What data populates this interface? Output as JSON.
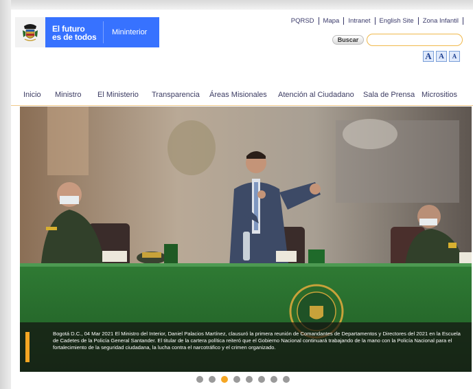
{
  "logo": {
    "line1": "El futuro",
    "line2": "es de todos",
    "ministry": "Mininterior"
  },
  "toplinks": [
    "PQRSD",
    "Mapa",
    "Intranet",
    "English Site",
    "Zona Infantil"
  ],
  "search": {
    "button_label": "Buscar",
    "value": "",
    "placeholder": ""
  },
  "font_size_controls": [
    "A",
    "A",
    "A"
  ],
  "nav": {
    "items": [
      "Inicio",
      "Ministro",
      "El Ministerio",
      "Transparencia",
      "Áreas Misionales",
      "Atención al Ciudadano",
      "Sala de Prensa",
      "Micrositios"
    ]
  },
  "hero": {
    "caption": "Bogotá D.C., 04 Mar 2021 El Ministro del Interior, Daniel Palacios Martínez, clausuró la primera reunión de Comandantes de Departamentos y Directores del 2021 en la Escuela de Cadetes de la Policía General Santander. El titular de la cartera política reiteró que el Gobierno Nacional continuará trabajando de la mano con la Policía Nacional para el fortalecimiento de la seguridad ciudadana, la lucha contra el narcotráfico y el crimen organizado.",
    "accent_color": "#f5a623"
  },
  "carousel": {
    "slide_count": 8,
    "active_index": 2
  },
  "colors": {
    "brand_blue": "#3772ff",
    "nav_text": "#3b3b62",
    "accent": "#f5a623"
  }
}
